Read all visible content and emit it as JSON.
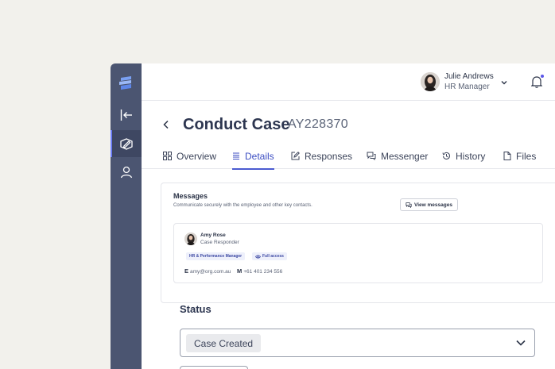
{
  "user": {
    "name": "Julie Andrews",
    "role": "HR Manager"
  },
  "case": {
    "title": "Conduct Case",
    "id": "AY228370"
  },
  "tabs": [
    {
      "label": "Overview",
      "icon": "grid-icon"
    },
    {
      "label": "Details",
      "icon": "list-icon",
      "active": true
    },
    {
      "label": "Responses",
      "icon": "edit-icon"
    },
    {
      "label": "Messenger",
      "icon": "chat-icon"
    },
    {
      "label": "History",
      "icon": "history-icon"
    },
    {
      "label": "Files",
      "icon": "file-icon"
    }
  ],
  "messages": {
    "title": "Messages",
    "subtitle": "Communicate securely with the employee and other key contacts.",
    "view_button": "View messages",
    "contact": {
      "name": "Amy Rose",
      "role": "Case Responder",
      "tags": [
        "HR & Performance Manager",
        "Full access"
      ],
      "email_label": "E",
      "email": "amy@org.com.au",
      "mobile_label": "M",
      "mobile": "+61 401 234 556"
    }
  },
  "status": {
    "label": "Status",
    "value": "Case Created"
  },
  "colors": {
    "sidebar": "#4b5571",
    "accent": "#4b5bd0",
    "background": "#f2f1ec",
    "notification_dot": "#5b57e8"
  }
}
